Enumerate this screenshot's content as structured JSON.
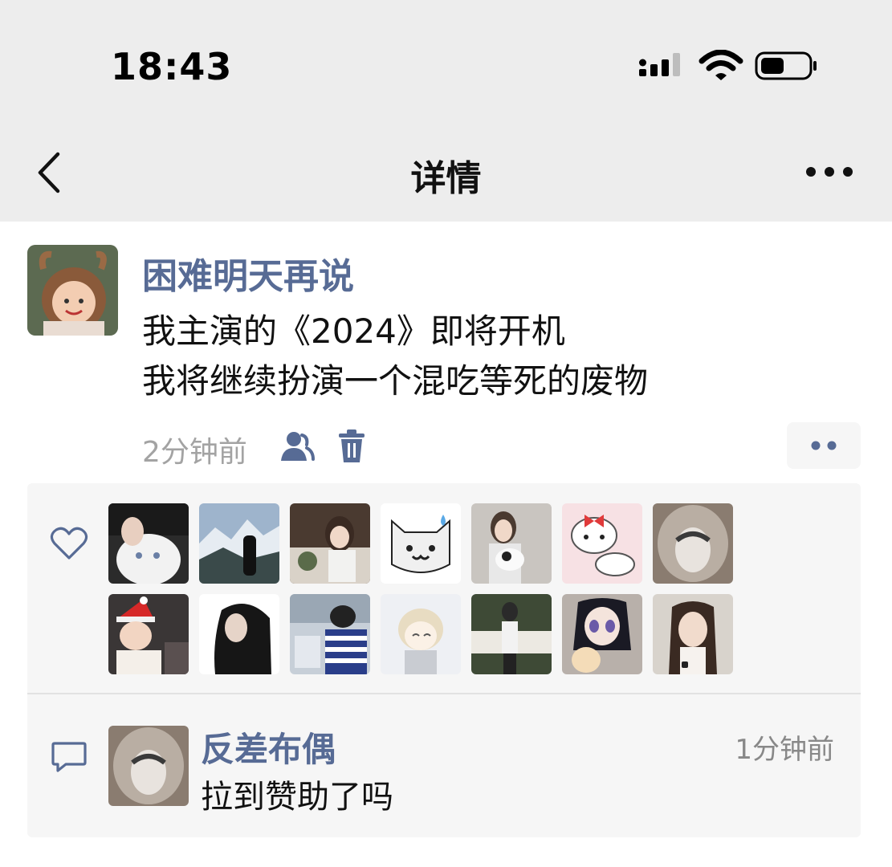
{
  "status_bar": {
    "time": "18:43"
  },
  "nav": {
    "title": "详情"
  },
  "post": {
    "author": "困难明天再说",
    "lines": [
      "我主演的《2024》即将开机",
      "我将继续扮演一个混吃等死的废物"
    ],
    "time": "2分钟前"
  },
  "likes": {
    "avatars": [
      "avatar-girl-white-cat",
      "avatar-mountain-person",
      "avatar-girl-eating",
      "avatar-white-cat-sticker",
      "avatar-girl-cat",
      "avatar-hello-kitty",
      "avatar-girl-fur-hood",
      "avatar-baby-santa-hat",
      "avatar-girl-dark",
      "avatar-boy-striped",
      "avatar-anime-girl",
      "avatar-person-sign",
      "avatar-anime-plush",
      "avatar-girl-long-hair"
    ]
  },
  "comment": {
    "author": "反差布偶",
    "time": "1分钟前",
    "text": "拉到赞助了吗"
  },
  "colors": {
    "link_blue": "#576b95",
    "header_gray": "#ededed",
    "panel_gray": "#f6f6f6"
  }
}
